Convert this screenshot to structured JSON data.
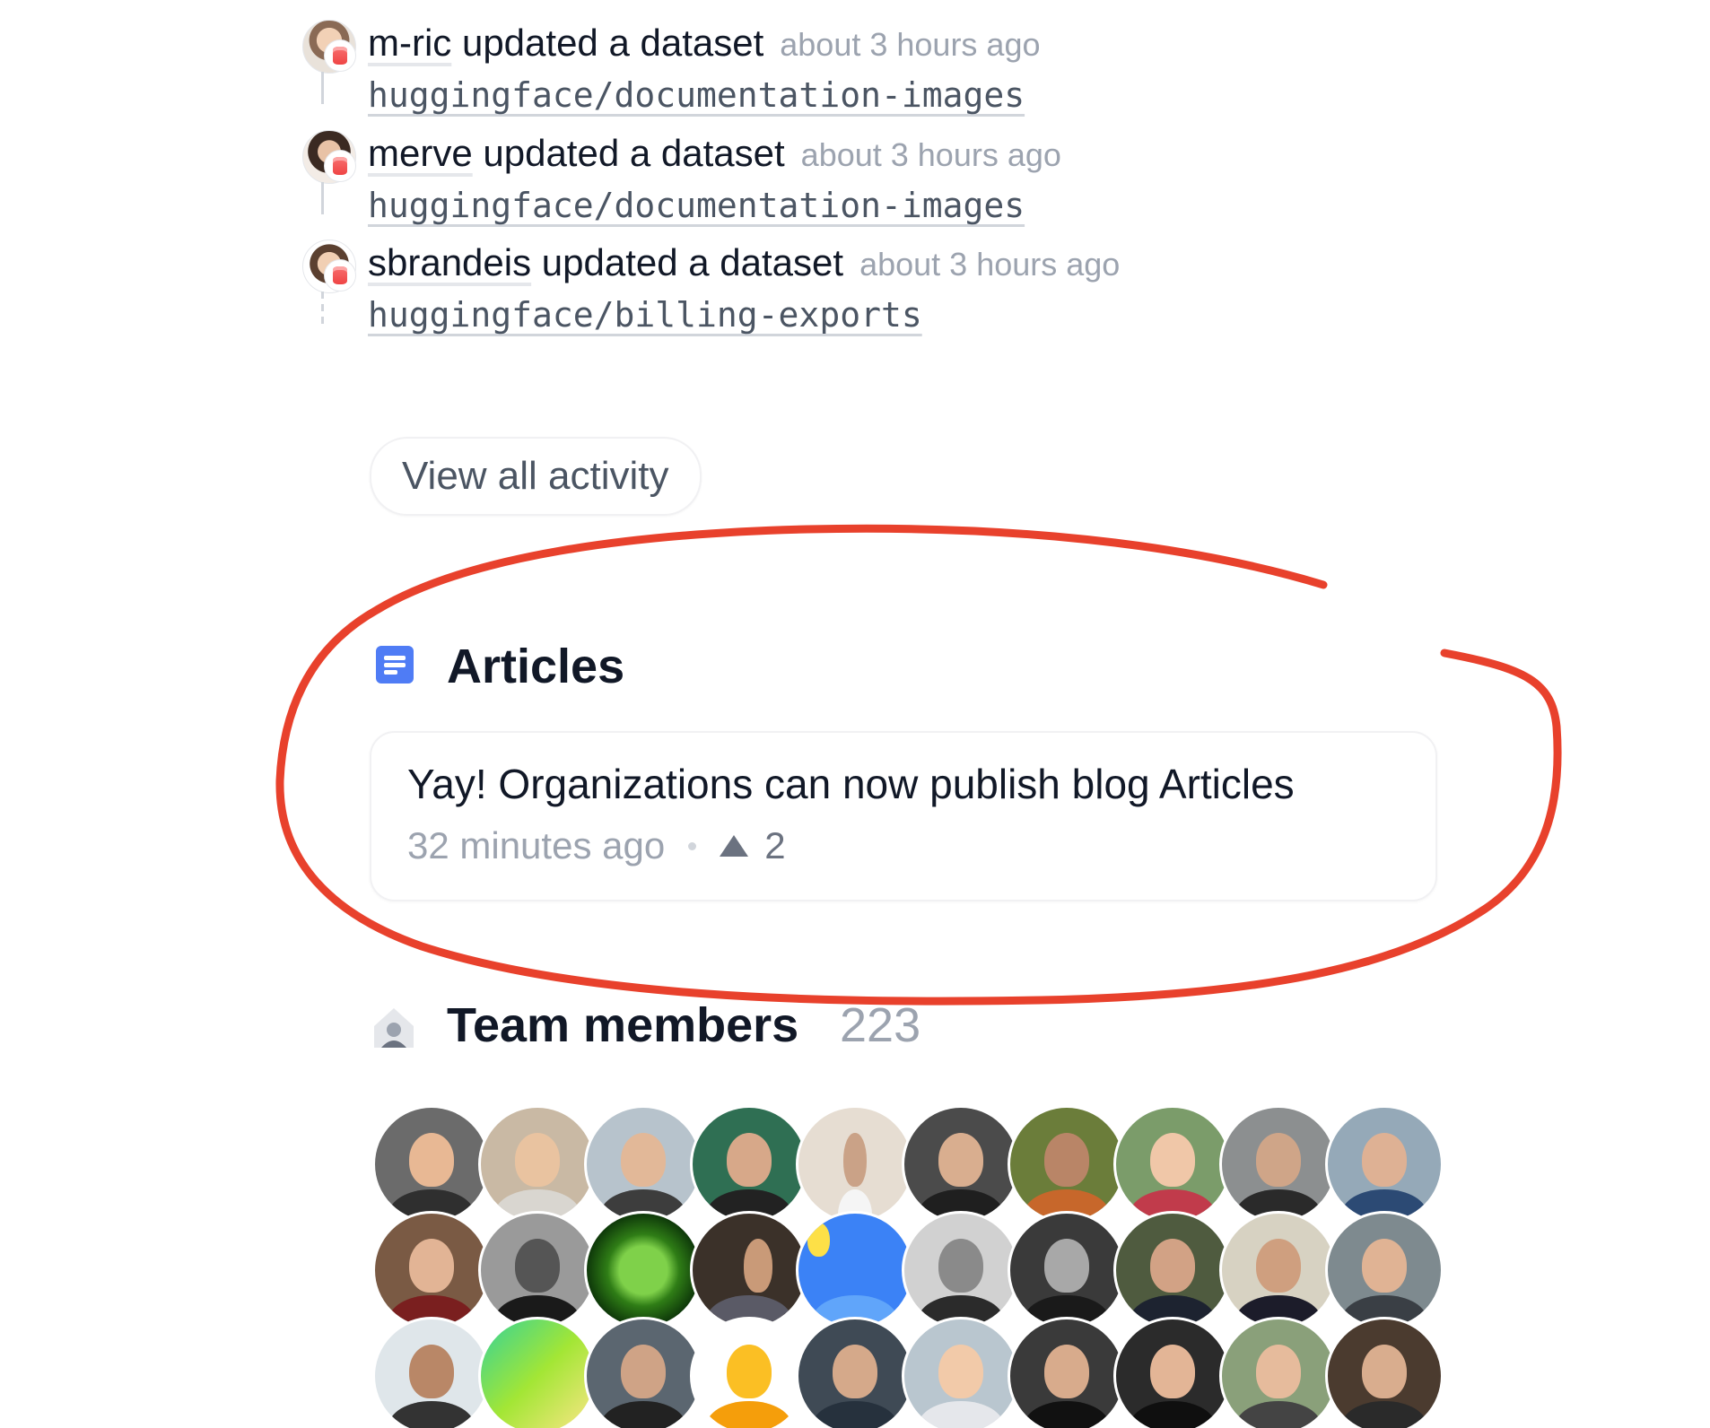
{
  "activity": [
    {
      "user": "m-ric",
      "action": " updated a dataset",
      "time": "about 3 hours ago",
      "repo": "huggingface/documentation-images"
    },
    {
      "user": "merve",
      "action": " updated a dataset",
      "time": "about 3 hours ago",
      "repo": "huggingface/documentation-images"
    },
    {
      "user": "sbrandeis",
      "action": " updated a dataset",
      "time": "about 3 hours ago",
      "repo": "huggingface/billing-exports"
    }
  ],
  "view_all_label": "View all activity",
  "articles": {
    "title": "Articles",
    "items": [
      {
        "title": "Yay! Organizations can now publish blog Articles",
        "time": "32 minutes ago",
        "likes": "2"
      }
    ]
  },
  "team": {
    "title": "Team members",
    "count": "223"
  },
  "colors": {
    "annotation": "#e8412c",
    "article_icon": "#4f7cf5",
    "dataset_badge": "#ef4444"
  },
  "icons": [
    "dataset-icon",
    "article-icon",
    "team-icon",
    "upvote-icon"
  ]
}
